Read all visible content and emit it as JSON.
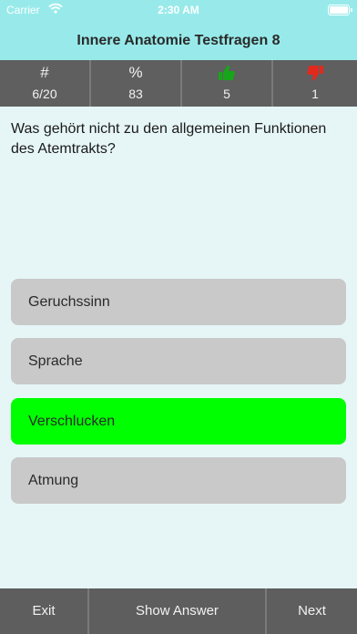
{
  "status_bar": {
    "carrier": "Carrier",
    "time": "2:30 AM"
  },
  "nav": {
    "title": "Innere Anatomie Testfragen 8"
  },
  "stats": {
    "progress": {
      "label": "#",
      "value": "6/20"
    },
    "percent": {
      "label": "%",
      "value": "83"
    },
    "correct": {
      "icon": "thumbs-up-icon",
      "value": "5",
      "color": "#17a51a"
    },
    "wrong": {
      "icon": "thumbs-down-icon",
      "value": "1",
      "color": "#e12a1d"
    }
  },
  "question": {
    "text": "Was gehört nicht zu den allgemeinen Funktionen des Atemtrakts?"
  },
  "answers": [
    {
      "label": "Geruchssinn",
      "state": "neutral"
    },
    {
      "label": "Sprache",
      "state": "neutral"
    },
    {
      "label": "Verschlucken",
      "state": "correct",
      "color": "#00ff00"
    },
    {
      "label": "Atmung",
      "state": "neutral"
    }
  ],
  "toolbar": {
    "exit": "Exit",
    "show_answer": "Show Answer",
    "next": "Next"
  },
  "colors": {
    "header": "#98eaea",
    "dark_bar": "#5f5f5f",
    "background": "#e6f6f7",
    "answer": "#c9c9c9"
  }
}
